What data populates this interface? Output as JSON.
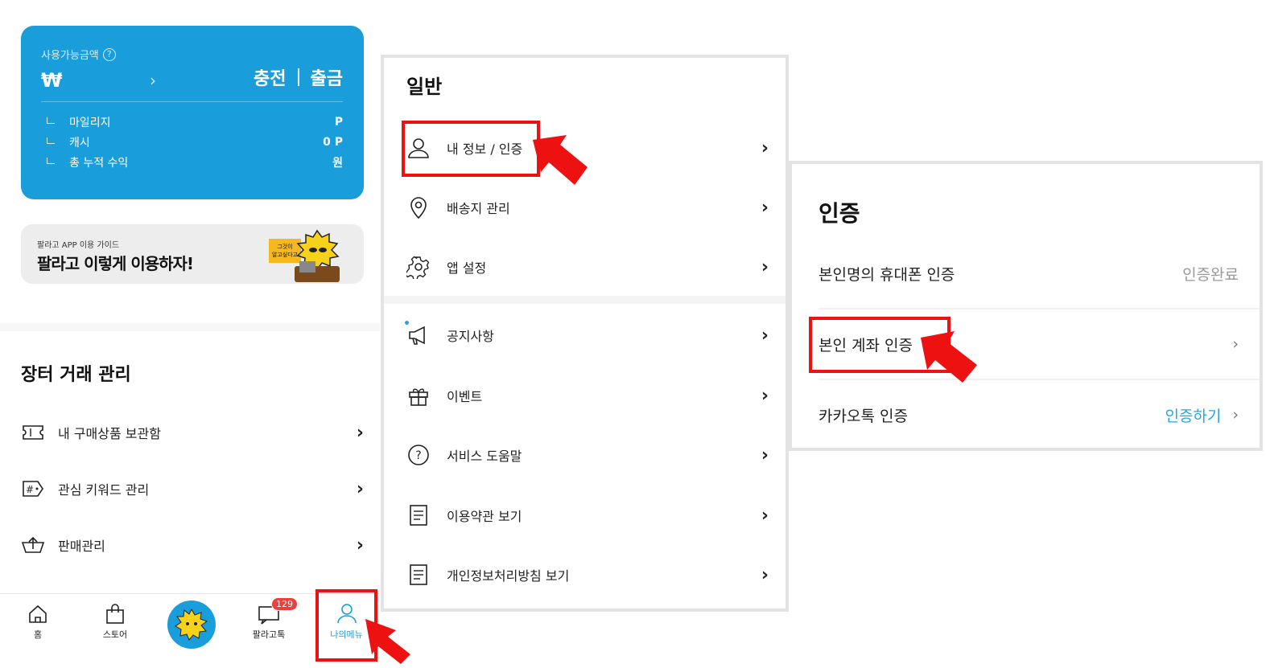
{
  "wallet": {
    "available_label": "사용가능금액",
    "help_icon": "?",
    "currency_symbol": "₩",
    "chevron": "›",
    "charge_label": "충전",
    "withdraw_label": "출금",
    "rows": [
      {
        "label": "마일리지",
        "value": "P"
      },
      {
        "label": "캐시",
        "value": "0 P"
      },
      {
        "label": "총 누적 수익",
        "value": "원"
      }
    ]
  },
  "guide_banner": {
    "small_text": "팔라고 APP 이용 가이드",
    "headline": "팔라고 이렇게 이용하자!",
    "mascot_tag1": "그것이",
    "mascot_tag2": "알고싶다고"
  },
  "market_section": {
    "title": "장터 거래 관리",
    "items": [
      {
        "label": "내 구매상품 보관함",
        "icon": "ticket-icon"
      },
      {
        "label": "관심 키워드 관리",
        "icon": "hash-tag-icon"
      },
      {
        "label": "판매관리",
        "icon": "sell-basket-icon"
      }
    ]
  },
  "tabbar": {
    "tabs": [
      {
        "label": "홈",
        "icon": "home-icon"
      },
      {
        "label": "스토어",
        "icon": "shopping-bag-icon"
      },
      {
        "label": "",
        "icon": "mascot-icon"
      },
      {
        "label": "팔라고톡",
        "icon": "chat-icon"
      },
      {
        "label": "나의메뉴",
        "icon": "user-icon"
      }
    ],
    "chat_badge": "129"
  },
  "general_panel": {
    "title": "일반",
    "items": [
      {
        "label": "내 정보 / 인증",
        "icon": "user-icon"
      },
      {
        "label": "배송지 관리",
        "icon": "location-pin-icon"
      },
      {
        "label": "앱 설정",
        "icon": "gear-icon"
      },
      {
        "label": "공지사항",
        "icon": "megaphone-icon"
      },
      {
        "label": "이벤트",
        "icon": "gift-icon"
      },
      {
        "label": "서비스 도움말",
        "icon": "help-circle-icon"
      },
      {
        "label": "이용약관 보기",
        "icon": "document-icon"
      },
      {
        "label": "개인정보처리방침 보기",
        "icon": "document-icon"
      }
    ]
  },
  "auth_panel": {
    "title": "인증",
    "items": [
      {
        "label": "본인명의 휴대폰 인증",
        "value": "인증완료"
      },
      {
        "label": "본인 계좌 인증",
        "value": ""
      },
      {
        "label": "카카오톡 인증",
        "value": "인증하기"
      }
    ]
  },
  "colors": {
    "brand_blue": "#1a9edb",
    "highlight_red": "#ee1111",
    "link_blue": "#2aa4e0",
    "muted_gray": "#9a9a9a"
  }
}
